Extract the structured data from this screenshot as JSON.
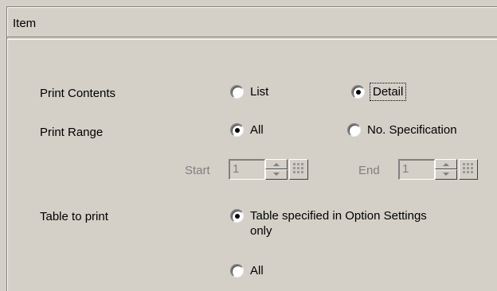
{
  "header": {
    "title": "Item"
  },
  "print_contents": {
    "label": "Print Contents",
    "options": [
      {
        "label": "List",
        "checked": false
      },
      {
        "label": "Detail",
        "checked": true
      }
    ]
  },
  "print_range": {
    "label": "Print Range",
    "options": [
      {
        "label": "All",
        "checked": true
      },
      {
        "label": "No. Specification",
        "checked": false
      }
    ],
    "start": {
      "label": "Start",
      "value": "1"
    },
    "end": {
      "label": "End",
      "value": "1"
    }
  },
  "table_to_print": {
    "label": "Table to print",
    "options": [
      {
        "label": "Table specified in Option Settings only",
        "checked": true
      },
      {
        "label": "All",
        "checked": false
      }
    ]
  }
}
